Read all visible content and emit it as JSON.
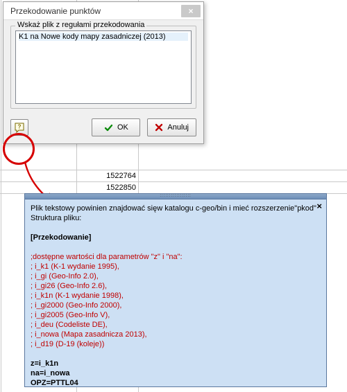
{
  "dialog": {
    "title": "Przekodowanie punktów",
    "group_label": "Wskaż plik z regułami przekodowania",
    "list": [
      "K1 na Nowe kody mapy zasadniczej (2013)"
    ],
    "ok_label": "OK",
    "cancel_label": "Anuluj"
  },
  "grid_values": [
    "1522764",
    "1522850"
  ],
  "tooltip": {
    "line1": "Plik tekstowy powinien znajdować sięw katalogu c-geo/bin i mieć rozszerzenie\"pkod\"",
    "line2": "Struktura pliku:",
    "section_title": "[Przekodowanie]",
    "comment_header": ";dostępne wartości dla parametrów \"z\" i \"na\":",
    "params": [
      "; i_k1 (K-1 wydanie 1995),",
      "; i_gi (Geo-Info 2.0),",
      "; i_gi26 (Geo-Info 2.6),",
      "; i_k1n (K-1 wydanie 1998),",
      "; i_gi2000 (Geo-Info 2000),",
      "; i_gi2005 (Geo-Info V),",
      "; i_deu (Codeliste DE),",
      "; i_nowa (Mapa zasadnicza 2013),",
      "; i_d19 (D-19 (koleje))"
    ],
    "footer": [
      "z=i_k1n",
      "na=i_nowa",
      "OPZ=PTTL04"
    ]
  }
}
